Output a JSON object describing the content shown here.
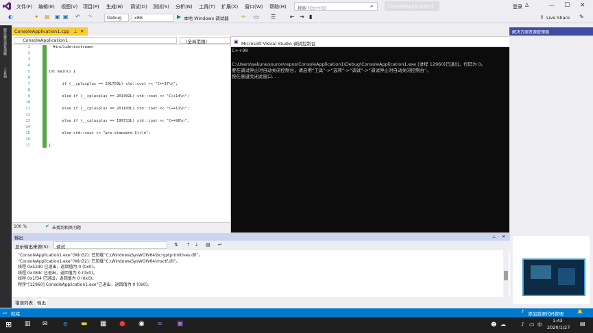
{
  "menu": {
    "items": [
      "文件(F)",
      "编辑(E)",
      "视图(V)",
      "项目(P)",
      "生成(B)",
      "调试(D)",
      "测试(S)",
      "分析(N)",
      "工具(T)",
      "扩展(X)",
      "窗口(W)",
      "帮助(H)"
    ],
    "search_placeholder": "搜索 (Ctrl+Q)",
    "solution_name": "ConsoleApplication1",
    "login": "登录"
  },
  "toolbar": {
    "config": "Debug",
    "platform": "x86",
    "run_label": "本地 Windows 调试器",
    "liveshare": "Live Share"
  },
  "sidebar": {
    "left_tabs": [
      "服务器资源管理器",
      "工具箱"
    ]
  },
  "editor": {
    "tab_label": "ConsoleApplication1.cpp",
    "nav_project": "ConsoleApplication1",
    "nav_scope": "(全局范围)",
    "lines": [
      {
        "n": "1",
        "code": "    #include<iostream>"
      },
      {
        "n": "2",
        "code": ""
      },
      {
        "n": "3",
        "code": ""
      },
      {
        "n": "4",
        "code": ""
      },
      {
        "n": "5",
        "code": "  int main() {"
      },
      {
        "n": "6",
        "code": ""
      },
      {
        "n": "7",
        "code": "        if (__cplusplus == 201703L) std::cout << \"C++17\\n\";"
      },
      {
        "n": "8",
        "code": ""
      },
      {
        "n": "9",
        "code": "        else if (__cplusplus == 201402L) std::cout << \"C++14\\n\";"
      },
      {
        "n": "10",
        "code": ""
      },
      {
        "n": "11",
        "code": "        else if (__cplusplus == 201103L) std::cout << \"C++11\\n\";"
      },
      {
        "n": "12",
        "code": ""
      },
      {
        "n": "13",
        "code": "        else if (__cplusplus == 199711L) std::cout << \"C++98\\n\";"
      },
      {
        "n": "14",
        "code": ""
      },
      {
        "n": "15",
        "code": "        else std::cout << \"pre-standard C++\\n\";"
      },
      {
        "n": "16",
        "code": ""
      },
      {
        "n": "17",
        "code": "  }"
      }
    ],
    "zoom": "100 %",
    "issues": "未找到相关问题"
  },
  "console": {
    "title": "Microsoft Visual Studio 调试控制台",
    "lines": [
      "C++98",
      "",
      "C:\\Users\\sakura\\source\\repos\\ConsoleApplication1\\Debug\\ConsoleApplication1.exe (进程 12960)已退出，代码为 0。",
      "要在调试停止时自动关闭控制台，请启用“工具”->“选项”->“调试”->“调试停止时自动关闭控制台”。",
      "按任意键关闭此窗口. . ."
    ]
  },
  "right_panel": {
    "title": "解决方案资源管理器"
  },
  "output": {
    "title": "输出",
    "source_label": "显示输出来源(S):",
    "source_value": "调试",
    "lines": [
      "“ConsoleApplication1.exe”(Win32): 已加载“C:\\Windows\\SysWOW64\\bcryptprimitives.dll”。",
      "“ConsoleApplication1.exe”(Win32): 已加载“C:\\Windows\\SysWOW64\\msctf.dll”。",
      "线程 0x52d0 已退出，返回值为 0 (0x0)。",
      "线程 0x38dc 已退出，返回值为 0 (0x0)。",
      "线程 0x1f34 已退出，返回值为 0 (0x0)。",
      "程序“[12960] ConsoleApplication1.exe”已退出，返回值为 0 (0x0)。"
    ],
    "tabs": [
      "错误列表",
      "输出"
    ]
  },
  "status": {
    "ready": "就绪",
    "source_control": "添加到源代码管理"
  },
  "taskbar": {
    "time": "1:43",
    "date": "2020/1/27",
    "ime": "中"
  },
  "colors": {
    "accent": "#007acc",
    "console_bg": "#0c0c0c",
    "tab_active": "#f9cc2f",
    "taskbar": "#1f1f1f"
  }
}
